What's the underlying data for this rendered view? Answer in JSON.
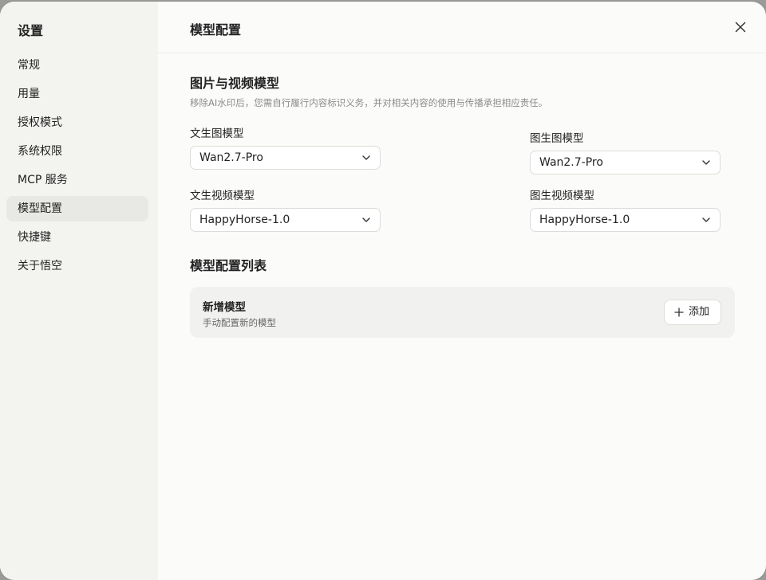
{
  "sidebar": {
    "title": "设置",
    "items": [
      {
        "label": "常规"
      },
      {
        "label": "用量"
      },
      {
        "label": "授权模式"
      },
      {
        "label": "系统权限"
      },
      {
        "label": "MCP 服务"
      },
      {
        "label": "模型配置",
        "active": true
      },
      {
        "label": "快捷键"
      },
      {
        "label": "关于悟空"
      }
    ]
  },
  "header": {
    "title": "模型配置",
    "close_icon": "close-icon"
  },
  "image_video_section": {
    "title": "图片与视频模型",
    "description": "移除AI水印后，您需自行履行内容标识义务，并对相关内容的使用与传播承担相应责任。",
    "text_to_image": {
      "label": "文生图模型",
      "value": "Wan2.7-Pro"
    },
    "image_to_image": {
      "label": "图生图模型",
      "value": "Wan2.7-Pro"
    },
    "text_to_video": {
      "label": "文生视频模型",
      "value": "HappyHorse-1.0"
    },
    "image_to_video": {
      "label": "图生视频模型",
      "value": "HappyHorse-1.0"
    }
  },
  "model_list_section": {
    "title": "模型配置列表",
    "new_model": {
      "title": "新增模型",
      "subtitle": "手动配置新的模型",
      "add_label": "添加"
    }
  }
}
